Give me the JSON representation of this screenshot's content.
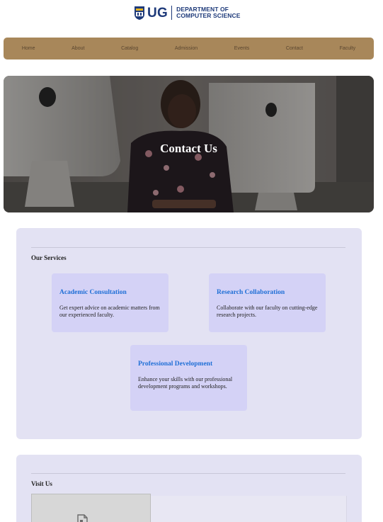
{
  "header": {
    "logo_text": "UG",
    "dept_line1": "DEPARTMENT OF",
    "dept_line2": "COMPUTER SCIENCE"
  },
  "nav": {
    "items": [
      {
        "label": "Home"
      },
      {
        "label": "About"
      },
      {
        "label": "Catalog"
      },
      {
        "label": "Admission"
      },
      {
        "label": "Events"
      },
      {
        "label": "Contact"
      },
      {
        "label": "Faculty"
      }
    ]
  },
  "hero": {
    "title": "Contact Us"
  },
  "services": {
    "title": "Our Services",
    "items": [
      {
        "title": "Academic Consultation",
        "text": "Get expert advice on academic matters from our experienced faculty."
      },
      {
        "title": "Research Collaboration",
        "text": "Collaborate with our faculty on cutting-edge research projects."
      },
      {
        "title": "Professional Development",
        "text": "Enhance your skills with our professional development programs and workshops."
      }
    ]
  },
  "visit": {
    "title": "Visit Us",
    "map_icon": "broken-image-icon"
  },
  "colors": {
    "nav_bg": "#a8875a",
    "card_bg": "#e3e2f3",
    "service_bg": "#d4d2f6",
    "service_title": "#1f6fd6",
    "brand": "#1e3a7a"
  }
}
